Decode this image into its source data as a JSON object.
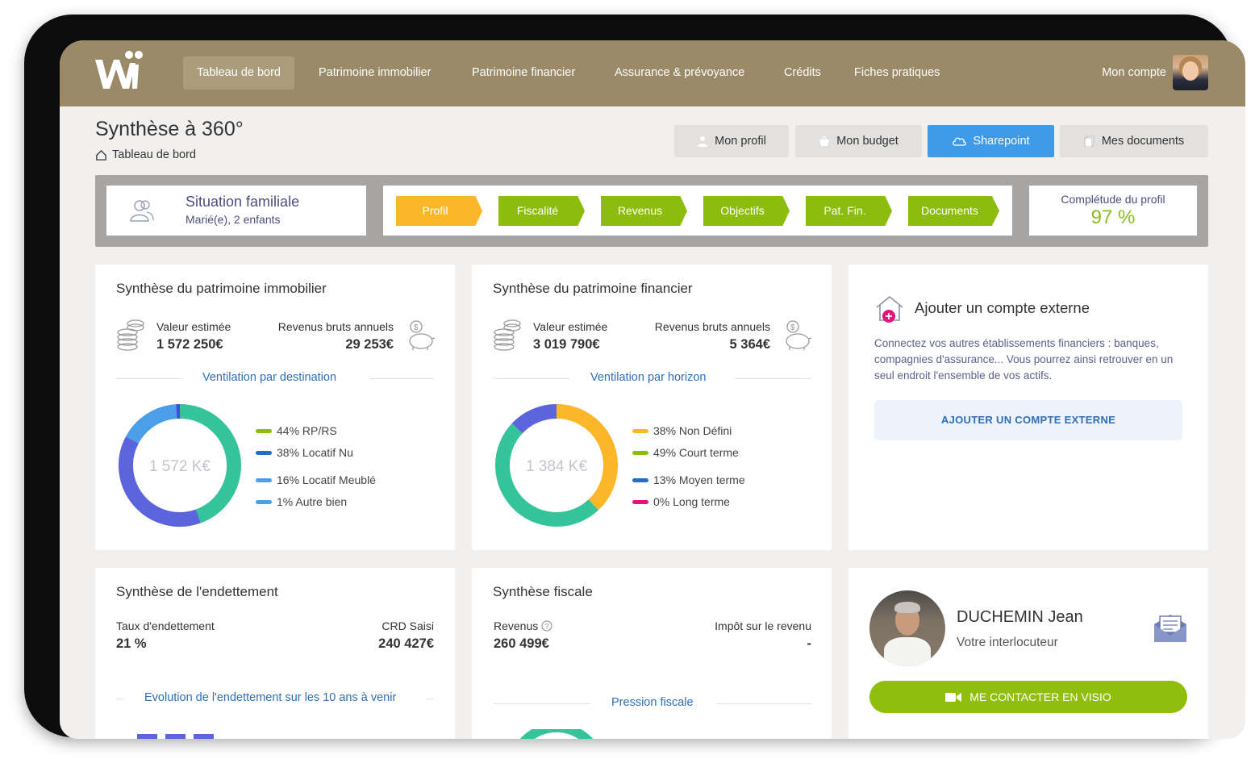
{
  "nav": {
    "items": [
      {
        "label": "Tableau de bord",
        "active": true
      },
      {
        "label": "Patrimoine immobilier",
        "active": false
      },
      {
        "label": "Patrimoine financier",
        "active": false
      },
      {
        "label": "Assurance & prévoyance",
        "active": false
      },
      {
        "label": "Crédits",
        "active": false
      },
      {
        "label": "Fiches pratiques",
        "active": false
      }
    ],
    "account_label": "Mon compte",
    "logo_icon": "wiizi-logo"
  },
  "header": {
    "title": "Synthèse à 360°",
    "breadcrumb": "Tableau de bord",
    "buttons": [
      {
        "label": "Mon profil",
        "icon": "user-icon"
      },
      {
        "label": "Mon budget",
        "icon": "basket-icon"
      },
      {
        "label": "Sharepoint",
        "icon": "cloud-icon"
      },
      {
        "label": "Mes documents",
        "icon": "document-icon"
      }
    ]
  },
  "profile_strip": {
    "family": {
      "title": "Situation familiale",
      "subtitle": "Marié(e), 2 enfants"
    },
    "steps": [
      {
        "label": "Profil",
        "color": "#fbb728"
      },
      {
        "label": "Fiscalité",
        "color": "#8cbd0e"
      },
      {
        "label": "Revenus",
        "color": "#8cbd0e"
      },
      {
        "label": "Objectifs",
        "color": "#8cbd0e"
      },
      {
        "label": "Pat. Fin.",
        "color": "#8cbd0e"
      },
      {
        "label": "Documents",
        "color": "#8cbd0e"
      }
    ],
    "completion": {
      "label": "Complétude du profil",
      "value": "97 %"
    }
  },
  "immobilier": {
    "title": "Synthèse du patrimoine immobilier",
    "value_label": "Valeur estimée",
    "value": "1 572 250€",
    "income_label": "Revenus bruts annuels",
    "income": "29 253€",
    "section": "Ventilation par destination",
    "center": "1 572 K€",
    "legend": [
      {
        "label": "44% RP/RS",
        "color": "#8cbd0e"
      },
      {
        "label": "38% Locatif Nu",
        "color": "#1f6fc5"
      },
      {
        "label": "16% Locatif Meublé",
        "color": "#4a9fe8"
      },
      {
        "label": "1% Autre bien",
        "color": "#4a9fe8"
      }
    ],
    "segments": [
      {
        "pct": 44,
        "color": "#35c49a"
      },
      {
        "pct": 38,
        "color": "#5b63dd"
      },
      {
        "pct": 16,
        "color": "#4a9fe8"
      },
      {
        "pct": 1,
        "color": "#3b55c8"
      }
    ]
  },
  "financier": {
    "title": "Synthèse du patrimoine financier",
    "value_label": "Valeur estimée",
    "value": "3 019 790€",
    "income_label": "Revenus bruts annuels",
    "income": "5 364€",
    "section": "Ventilation par horizon",
    "center": "1 384 K€",
    "legend": [
      {
        "label": "38% Non Défini",
        "color": "#fbb728"
      },
      {
        "label": "49% Court terme",
        "color": "#8cbd0e"
      },
      {
        "label": "13% Moyen terme",
        "color": "#1f6fc5"
      },
      {
        "label": "0% Long terme",
        "color": "#e0157b"
      }
    ],
    "segments": [
      {
        "pct": 38,
        "color": "#fbb728"
      },
      {
        "pct": 49,
        "color": "#35c49a"
      },
      {
        "pct": 13,
        "color": "#5b63dd"
      },
      {
        "pct": 0,
        "color": "#e0157b"
      }
    ]
  },
  "external": {
    "title": "Ajouter un compte externe",
    "text": "Connectez vos autres établissements financiers : banques, compagnies d'assurance... Vous pourrez ainsi retrouver en un seul endroit l'ensemble de vos actifs.",
    "button": "AJOUTER UN COMPTE EXTERNE"
  },
  "endettement": {
    "title": "Synthèse de l'endettement",
    "rate_label": "Taux d'endettement",
    "rate": "21 %",
    "crd_label": "CRD Saisi",
    "crd": "240 427€",
    "section": "Evolution de l'endettement sur les 10 ans à venir"
  },
  "fiscale": {
    "title": "Synthèse fiscale",
    "revenus_label": "Revenus",
    "revenus": "260 499€",
    "impot_label": "Impôt sur le revenu",
    "impot": "-",
    "section": "Pression fiscale"
  },
  "contact": {
    "name": "DUCHEMIN Jean",
    "role": "Votre interlocuteur",
    "button": "ME CONTACTER EN VISIO"
  }
}
